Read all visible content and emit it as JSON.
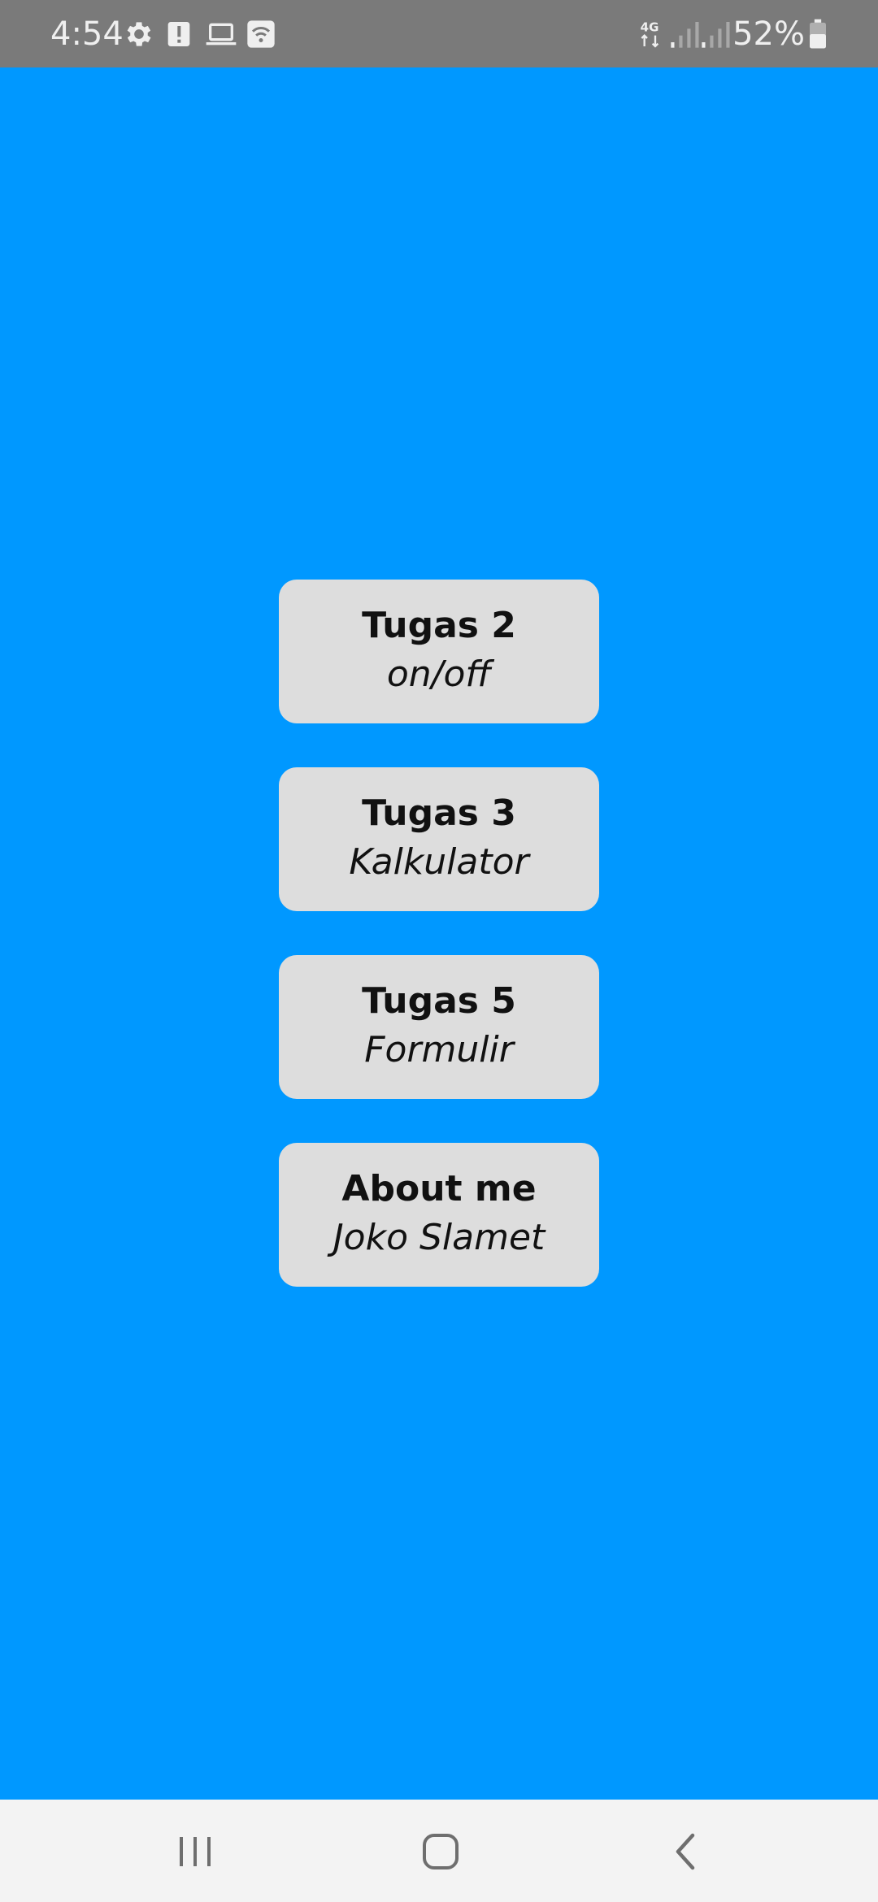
{
  "status_bar": {
    "time": "4:54",
    "battery": "52%",
    "network": "4G",
    "icons": [
      "gear-icon",
      "alert-icon",
      "laptop-icon",
      "wifi-icon",
      "network-4g-icon",
      "signal-icon",
      "signal-icon",
      "battery-icon"
    ],
    "background": "#7A7A7A"
  },
  "menu": {
    "background": "#0098FF",
    "items": [
      {
        "title": "Tugas 2",
        "subtitle": "on/off"
      },
      {
        "title": "Tugas 3",
        "subtitle": "Kalkulator"
      },
      {
        "title": "Tugas 5",
        "subtitle": "Formulir"
      },
      {
        "title": "About me",
        "subtitle": "Joko Slamet"
      }
    ]
  },
  "nav_bar": {
    "icons": [
      "recents-icon",
      "home-icon",
      "back-icon"
    ]
  }
}
